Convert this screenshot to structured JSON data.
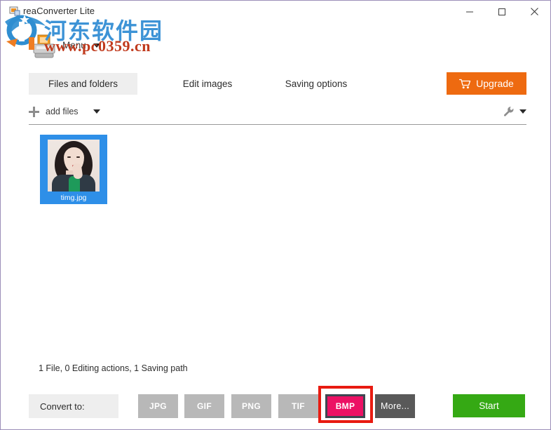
{
  "window": {
    "title": "reaConverter Lite",
    "icon": "app-icon",
    "controls": {
      "minimize": "minimize",
      "maximize": "maximize",
      "close": "close"
    }
  },
  "watermark": {
    "chinese": "河东软件园",
    "url": "www.pc0359.cn",
    "chinese_color": "#3d93d6",
    "url_color": "#c03a1d"
  },
  "menubar": {
    "menu_label": "Menu"
  },
  "tabs": [
    {
      "label": "Files and folders",
      "active": true
    },
    {
      "label": "Edit images",
      "active": false
    },
    {
      "label": "Saving options",
      "active": false
    }
  ],
  "upgrade": {
    "label": "Upgrade",
    "color": "#ee6a10",
    "icon": "shopping-cart-icon"
  },
  "toolbar": {
    "add_files_label": "add files",
    "add_icon": "plus-icon",
    "dropdown_icon": "chevron-down-icon",
    "settings_icon": "wrench-icon"
  },
  "files": [
    {
      "name": "timg.jpg",
      "selected": true,
      "selection_color": "#2e8fe8"
    }
  ],
  "status": {
    "text": "1 File, 0 Editing actions, 1 Saving path"
  },
  "bottom": {
    "convert_to_label": "Convert to:",
    "formats": [
      {
        "label": "JPG",
        "selected": false
      },
      {
        "label": "GIF",
        "selected": false
      },
      {
        "label": "PNG",
        "selected": false
      },
      {
        "label": "TIF",
        "selected": false
      },
      {
        "label": "BMP",
        "selected": true
      },
      {
        "label": "More...",
        "selected": false
      }
    ],
    "selected_format": "BMP",
    "selected_color": "#ec1164",
    "start_label": "Start",
    "start_color": "#35a914"
  },
  "annotation": {
    "target": "BMP",
    "color": "#e81b11"
  }
}
